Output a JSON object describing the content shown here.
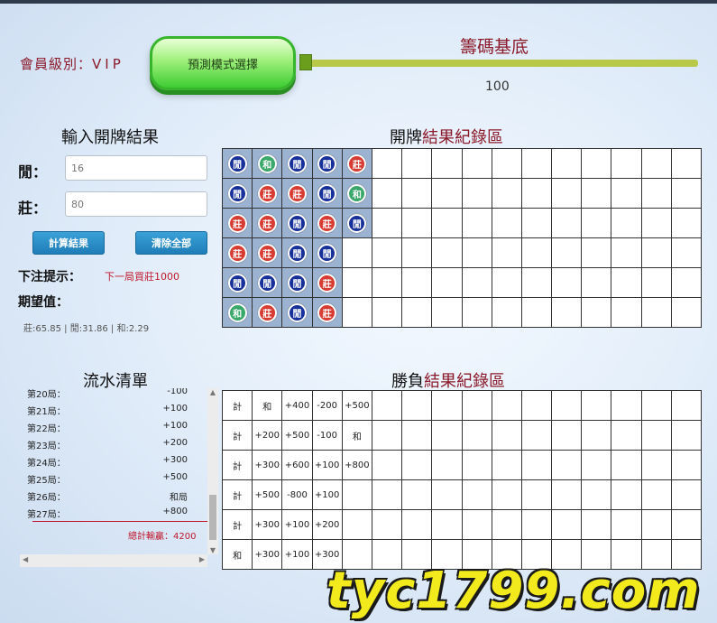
{
  "header": {
    "member_label": "會員級別：",
    "member_value": "VIP",
    "mode_button": "預測模式選擇",
    "chip_base_label": "籌碼基底",
    "chip_base_value": "100"
  },
  "input": {
    "title": "輸入開牌結果",
    "player_label": "閒：",
    "player_value": "16",
    "banker_label": "莊：",
    "banker_value": "80",
    "calc_button": "計算結果",
    "clear_button": "清除全部",
    "bet_hint_label": "下注提示：",
    "bet_hint_value": "下一局買莊1000",
    "ev_label": "期望值：",
    "ev_value": "莊:65.85 | 閒:31.86 | 和:2.29"
  },
  "results_board": {
    "title_prefix": "開牌",
    "title_highlight": "結果紀錄區",
    "columns": [
      [
        "閒",
        "閒",
        "莊",
        "莊",
        "閒",
        "和"
      ],
      [
        "和",
        "莊",
        "莊",
        "莊",
        "閒",
        "莊"
      ],
      [
        "閒",
        "莊",
        "閒",
        "閒",
        "閒",
        "閒"
      ],
      [
        "閒",
        "閒",
        "莊",
        "閒",
        "莊",
        "莊"
      ],
      [
        "莊",
        "和",
        "閒"
      ]
    ]
  },
  "ledger": {
    "title": "流水清單",
    "rows": [
      {
        "label": "第20局：",
        "value": "-100"
      },
      {
        "label": "第21局：",
        "value": "+100"
      },
      {
        "label": "第22局：",
        "value": "+100"
      },
      {
        "label": "第23局：",
        "value": "+200"
      },
      {
        "label": "第24局：",
        "value": "+300"
      },
      {
        "label": "第25局：",
        "value": "+500"
      },
      {
        "label": "第26局：",
        "value": "和局"
      },
      {
        "label": "第27局：",
        "value": "+800"
      }
    ],
    "total": "總計輸贏：4200"
  },
  "winloss_board": {
    "title_prefix": "勝負",
    "title_highlight": "結果紀錄區",
    "rows": [
      [
        "計",
        "和",
        "+400",
        "-200",
        "+500"
      ],
      [
        "計",
        "+200",
        "+500",
        "-100",
        "和"
      ],
      [
        "計",
        "+300",
        "+600",
        "+100",
        "+800"
      ],
      [
        "計",
        "+500",
        "-800",
        "+100",
        ""
      ],
      [
        "計",
        "+300",
        "+100",
        "+200",
        ""
      ],
      [
        "和",
        "+300",
        "+100",
        "+300",
        ""
      ]
    ]
  },
  "watermark": "tyc1799.com"
}
